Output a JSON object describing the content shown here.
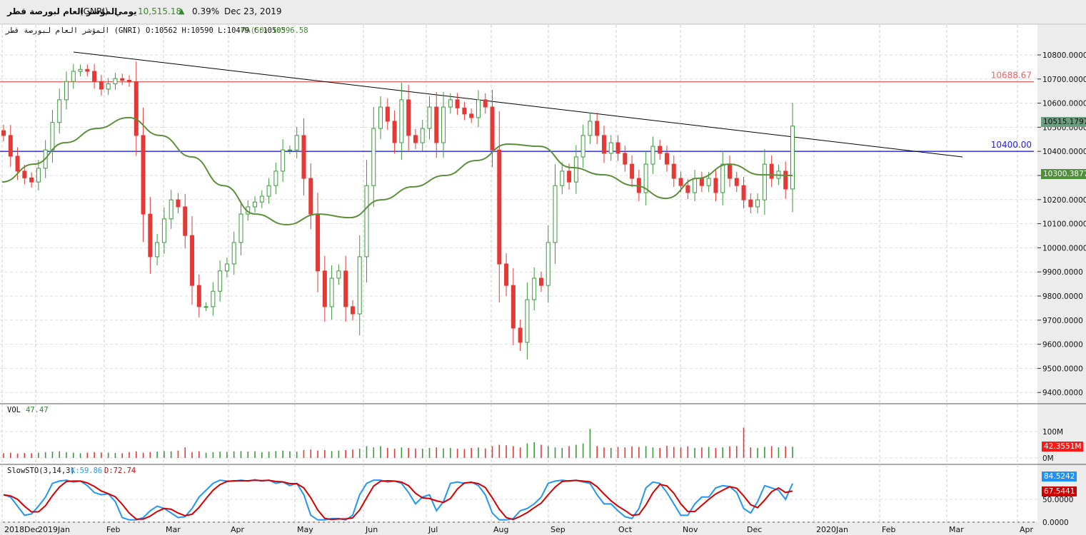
{
  "header": {
    "instrument_name": "المؤشر العام لبورصة قطر",
    "symbol": "(GNRI)",
    "period": "يومي",
    "last_price": "10,515.18",
    "change_icon": "triangle-up-icon",
    "change_pct": "0.39%",
    "date": "Dec 23, 2019"
  },
  "legend": {
    "ohlc": "المؤشر العام لبورصة قطر (GNRI) O:10562 H:10590 L:10479 C:10505",
    "ma_label": "MA(50)",
    "ma_value": "10396.58",
    "vol_label": "VOL",
    "vol_value": "47.47",
    "sto_label": "SlowSTO(3,14,3)",
    "sto_k": "K:59.86",
    "sto_d": "D:72.74"
  },
  "tags": {
    "price": "10515.1797",
    "ma": "10300.3877",
    "volume": "42.3551M",
    "sto_k": "84.5242",
    "sto_d": "67.5441"
  },
  "colors": {
    "up": "#3a9a3a",
    "down": "#e53935",
    "ma": "#5b8f3a",
    "resistance": "#f06060",
    "support": "#2020e0",
    "trendline": "#000000",
    "sto_k": "#2196f3",
    "sto_d": "#d40000"
  },
  "chart_data": [
    {
      "type": "candlestick",
      "ylim": [
        9350,
        10850
      ],
      "y_ticks": [
        "10800.0000",
        "10700.0000",
        "10600.0000",
        "10500.0000",
        "10400.0000",
        "10300.0000",
        "10200.0000",
        "10100.0000",
        "10000.0000",
        "9900.0000",
        "9800.0000",
        "9700.0000",
        "9600.0000",
        "9500.0000",
        "9400.0000"
      ],
      "x_ticks": [
        "2018Dec",
        "2019Jan",
        "Feb",
        "Mar",
        "Apr",
        "May",
        "Jun",
        "Jul",
        "Aug",
        "Sep",
        "Oct",
        "Nov",
        "Dec",
        "2020Jan",
        "Feb",
        "Mar",
        "Apr"
      ],
      "close": [
        10466,
        10380,
        10318,
        10290,
        10273,
        10330,
        10406,
        10520,
        10614,
        10690,
        10732,
        10740,
        10732,
        10690,
        10658,
        10680,
        10702,
        10695,
        10688,
        10466,
        10140,
        9963,
        10022,
        10120,
        10199,
        10170,
        10051,
        9844,
        9756,
        9756,
        9820,
        9904,
        9933,
        10022,
        10140,
        10170,
        10190,
        10214,
        10258,
        10318,
        10406,
        10406,
        10466,
        10288,
        10140,
        9904,
        9756,
        9874,
        9904,
        9756,
        9726,
        9963,
        10258,
        10495,
        10584,
        10525,
        10436,
        10614,
        10466,
        10436,
        10495,
        10584,
        10436,
        10584,
        10614,
        10580,
        10555,
        10540,
        10614,
        10584,
        10406,
        9933,
        9844,
        9667,
        9608,
        9785,
        9874,
        9844,
        10022,
        10258,
        10318,
        10273,
        10377,
        10466,
        10525,
        10466,
        10392,
        10436,
        10392,
        10347,
        10288,
        10229,
        10347,
        10421,
        10392,
        10347,
        10288,
        10258,
        10229,
        10288,
        10258,
        10288,
        10229,
        10347,
        10288,
        10258,
        10199,
        10170,
        10199,
        10347,
        10288,
        10318,
        10244,
        10505
      ],
      "ma50": [
        10273,
        10347,
        10436,
        10495,
        10540,
        10466,
        10377,
        10258,
        10140,
        10096,
        10140,
        10125,
        10199,
        10253,
        10300,
        10362,
        10430,
        10421,
        10333,
        10303,
        10258,
        10205,
        10288,
        10347,
        10303,
        10300
      ],
      "horizontal_lines": [
        {
          "label": "10688.67",
          "value": 10688.67
        },
        {
          "label": "10400.00",
          "value": 10400.0
        }
      ],
      "trendline": {
        "from": 10812,
        "to": 10377
      }
    },
    {
      "type": "bar",
      "title": "VOL",
      "y_ticks": [
        "100M",
        "0M"
      ],
      "values_millions": [
        18,
        20,
        17,
        19,
        18,
        20,
        22,
        24,
        25,
        22,
        20,
        18,
        20,
        22,
        21,
        20,
        19,
        18,
        22,
        25,
        20,
        22,
        24,
        26,
        25,
        28,
        40,
        22,
        25,
        20,
        22,
        24,
        23,
        25,
        26,
        24,
        25,
        22,
        24,
        26,
        28,
        25,
        24,
        30,
        32,
        28,
        30,
        26,
        28,
        30,
        32,
        35,
        45,
        40,
        45,
        38,
        35,
        40,
        38,
        36,
        35,
        38,
        40,
        36,
        38,
        35,
        34,
        38,
        40,
        36,
        45,
        50,
        48,
        45,
        40,
        55,
        60,
        50,
        45,
        40,
        38,
        45,
        50,
        55,
        110,
        45,
        40,
        38,
        42,
        40,
        44,
        42,
        45,
        40,
        38,
        46,
        42,
        40,
        44,
        38,
        40,
        42,
        38,
        40,
        44,
        45,
        115,
        40,
        38,
        42,
        45,
        40,
        44,
        42.36
      ]
    },
    {
      "type": "line",
      "title": "SlowSTO(3,14,3)",
      "y_ticks": [
        "50.0000",
        "0.0000"
      ],
      "ylim": [
        0,
        100
      ],
      "k": [
        60,
        55,
        35,
        15,
        18,
        35,
        55,
        85,
        90,
        92,
        88,
        90,
        80,
        65,
        60,
        62,
        45,
        10,
        5,
        5,
        10,
        25,
        35,
        30,
        20,
        10,
        12,
        30,
        55,
        70,
        85,
        92,
        90,
        90,
        92,
        90,
        93,
        90,
        92,
        85,
        88,
        80,
        85,
        60,
        15,
        5,
        5,
        8,
        8,
        5,
        15,
        60,
        85,
        92,
        92,
        88,
        90,
        85,
        65,
        40,
        55,
        60,
        25,
        45,
        85,
        88,
        85,
        88,
        80,
        60,
        20,
        5,
        5,
        8,
        25,
        30,
        40,
        55,
        85,
        90,
        92,
        90,
        92,
        88,
        85,
        60,
        40,
        40,
        25,
        12,
        8,
        30,
        75,
        88,
        85,
        65,
        40,
        15,
        15,
        40,
        55,
        55,
        75,
        80,
        78,
        65,
        30,
        20,
        45,
        80,
        75,
        70,
        50,
        84.52
      ]
    }
  ]
}
